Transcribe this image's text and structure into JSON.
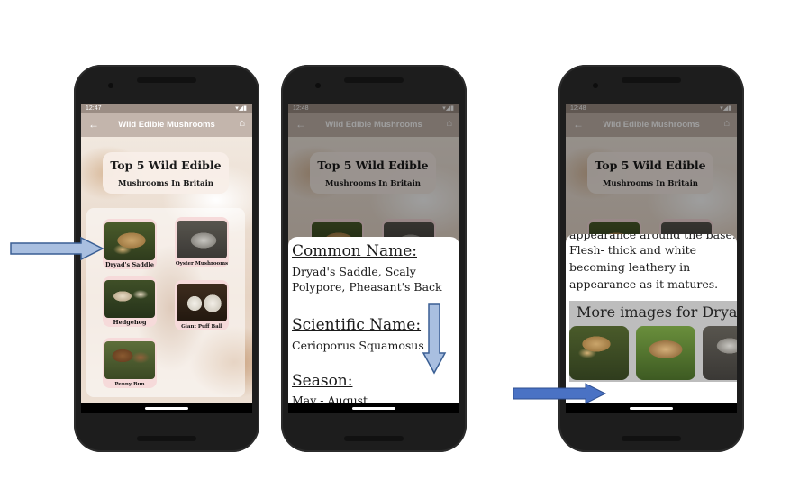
{
  "app": {
    "title": "Wild Edible Mushrooms",
    "status_time_1": "12:47",
    "status_time_2": "12:48",
    "status_time_3": "12:48",
    "back_icon": "arrow-left-icon",
    "home_icon": "home-icon"
  },
  "home": {
    "heading_line1": "Top 5 Wild Edible",
    "heading_line2": "Mushrooms In Britain",
    "mushrooms": [
      {
        "label": "Dryad's Saddle"
      },
      {
        "label": "Oyster Mushrooms"
      },
      {
        "label": "Hedgehog"
      },
      {
        "label": "Giant Puff Ball"
      },
      {
        "label": "Penny Bun"
      }
    ]
  },
  "detail": {
    "common_name_heading": "Common Name:",
    "common_name_value_line1": "Dryad's Saddle, Scaly",
    "common_name_value_line2": "Polypore, Pheasant's Back",
    "scientific_name_heading": "Scientific Name:",
    "scientific_name_value": "Cerioporus Squamosus",
    "season_heading": "Season:",
    "season_value": "May - August"
  },
  "detail_scrolled": {
    "text_line1": "appearance around the base.",
    "text_line2": "Flesh- thick and white",
    "text_line3": "becoming leathery in",
    "text_line4": "appearance as it matures.",
    "more_images_title": "More images for Dryad's Saddle"
  },
  "colors": {
    "arrow_fill": "#a9bfe0",
    "arrow_stroke": "#3a5f94",
    "arrow3_fill": "#4a72c4",
    "appbar": "#c3b5ac"
  }
}
